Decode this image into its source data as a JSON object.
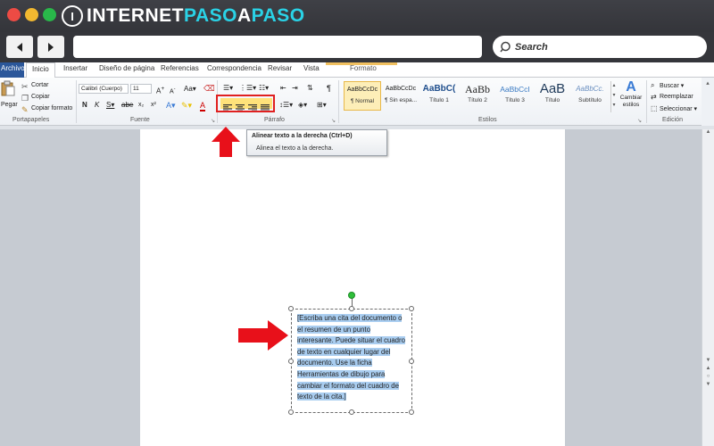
{
  "browser": {
    "logo": {
      "part1": "INTERNET",
      "part2": "PASO",
      "part3": "A",
      "part4": "PASO",
      "mark": "I"
    },
    "search_placeholder": "Search",
    "back_icon": "back-arrow-icon",
    "forward_icon": "forward-arrow-icon",
    "colors": {
      "red": "#ed4b44",
      "yellow": "#f2b830",
      "green": "#29b84a",
      "brand_cyan": "#2ad2e6"
    }
  },
  "word": {
    "tabs": [
      "Archivo",
      "Inicio",
      "Insertar",
      "Diseño de página",
      "Referencias",
      "Correspondencia",
      "Revisar",
      "Vista",
      "Formato"
    ],
    "clipboard": {
      "paste": "Pegar",
      "cut": "Cortar",
      "copy": "Copiar",
      "format_painter": "Copiar formato",
      "label": "Portapapeles"
    },
    "font": {
      "name": "Calibri (Cuerpo)",
      "size": "11",
      "label": "Fuente"
    },
    "paragraph": {
      "label": "Párrafo"
    },
    "styles": {
      "label": "Estilos",
      "items": [
        {
          "sample": "AaBbCcDc",
          "name": "¶ Normal"
        },
        {
          "sample": "AaBbCcDc",
          "name": "¶ Sin espa..."
        },
        {
          "sample": "AaBbC(",
          "name": "Título 1"
        },
        {
          "sample": "AaBb",
          "name": "Título 2"
        },
        {
          "sample": "AaBbCcI",
          "name": "Título 3"
        },
        {
          "sample": "AaB",
          "name": "Título"
        },
        {
          "sample": "AaBbCc.",
          "name": "Subtítulo"
        }
      ],
      "change": "Cambiar estilos"
    },
    "editing": {
      "find": "Buscar",
      "replace": "Reemplazar",
      "select": "Seleccionar",
      "label": "Edición"
    },
    "tooltip": {
      "title": "Alinear texto a la derecha (Ctrl+D)",
      "body": "Alinea el texto a la derecha."
    },
    "textbox_text": "[Escriba una cita del documento o el resumen de un punto interesante. Puede situar el cuadro de texto en cualquier lugar del documento. Use la ficha Herramientas de dibujo para cambiar el formato del cuadro de texto de la cita.]"
  }
}
